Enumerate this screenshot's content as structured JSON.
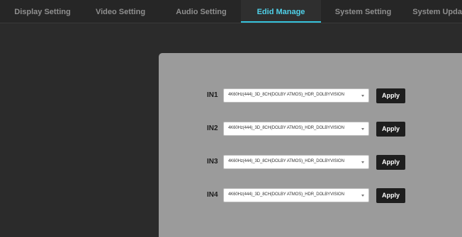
{
  "tabs": [
    {
      "label": "Display Setting"
    },
    {
      "label": "Video Setting"
    },
    {
      "label": "Audio Setting"
    },
    {
      "label": "Edid Manage"
    },
    {
      "label": "System Setting"
    },
    {
      "label": "System Update"
    }
  ],
  "active_tab": "Edid Manage",
  "colors": {
    "accent": "#36c3dc",
    "panel": "#9b9b9b",
    "apply_button": "#1e1e1e"
  },
  "edid": {
    "rows": [
      {
        "input": "IN1",
        "value": "4K60Hz(444)_3D_8CH(DOLBY ATMOS)_HDR_DOLBYVISION",
        "apply": "Apply"
      },
      {
        "input": "IN2",
        "value": "4K60Hz(444)_3D_8CH(DOLBY ATMOS)_HDR_DOLBYVISION",
        "apply": "Apply"
      },
      {
        "input": "IN3",
        "value": "4K60Hz(444)_3D_8CH(DOLBY ATMOS)_HDR_DOLBYVISION",
        "apply": "Apply"
      },
      {
        "input": "IN4",
        "value": "4K60Hz(444)_3D_8CH(DOLBY ATMOS)_HDR_DOLBYVISION",
        "apply": "Apply"
      }
    ]
  }
}
